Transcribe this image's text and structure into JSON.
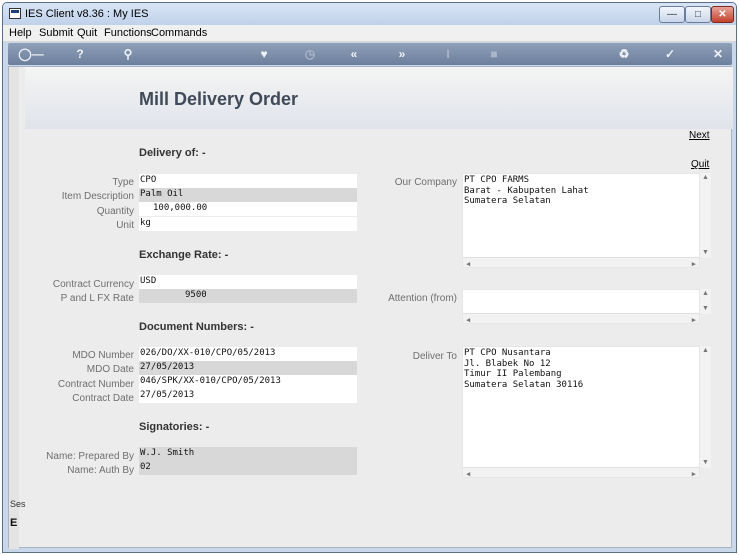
{
  "window": {
    "title": "IES Client v8.36 : My IES"
  },
  "menu": [
    "Help",
    "Submit",
    "Quit",
    "Functions",
    "Commands"
  ],
  "toolbar": {
    "icons": [
      "key-icon",
      "help-icon",
      "search-icon",
      "heart-icon",
      "clock-icon",
      "rewind-icon",
      "fast-forward-icon",
      "text-cursor-icon",
      "stop-icon",
      "recycle-icon",
      "check-icon",
      "close-icon"
    ]
  },
  "page": {
    "title": "Mill Delivery Order"
  },
  "links": {
    "next": "Next",
    "quit": "Quit"
  },
  "sections": {
    "delivery": "Delivery of: -",
    "exchange": "Exchange Rate: -",
    "documents": "Document Numbers: -",
    "signatories": "Signatories: -"
  },
  "fields": {
    "type": {
      "label": "Type",
      "value": "CPO"
    },
    "item_description": {
      "label": "Item Description",
      "value": "Palm Oil"
    },
    "quantity": {
      "label": "Quantity",
      "value": "100,000.00"
    },
    "unit": {
      "label": "Unit",
      "value": "kg"
    },
    "contract_currency": {
      "label": "Contract Currency",
      "value": "USD"
    },
    "fx_rate": {
      "label": "P and L  FX Rate",
      "value": "9500"
    },
    "mdo_number": {
      "label": "MDO Number",
      "value": "026/DO/XX-010/CPO/05/2013"
    },
    "mdo_date": {
      "label": "MDO Date",
      "value": "27/05/2013"
    },
    "contract_number": {
      "label": "Contract Number",
      "value": "046/SPK/XX-010/CPO/05/2013"
    },
    "contract_date": {
      "label": "Contract Date",
      "value": "27/05/2013"
    },
    "prepared_by": {
      "label": "Name: Prepared By",
      "value": "W.J. Smith"
    },
    "auth_by": {
      "label": "Name: Auth By",
      "value": "02"
    }
  },
  "memos": {
    "our_company": {
      "label": "Our Company",
      "value": "PT CPO FARMS\nBarat - Kabupaten Lahat\nSumatera Selatan"
    },
    "attention": {
      "label": "Attention (from)",
      "value": ""
    },
    "deliver_to": {
      "label": "Deliver To",
      "value": "PT CPO Nusantara\nJl. Blabek No 12\nTimur II Palembang\nSumatera Selatan 30116"
    }
  },
  "session": {
    "label": "Ses",
    "glyph": "E"
  }
}
